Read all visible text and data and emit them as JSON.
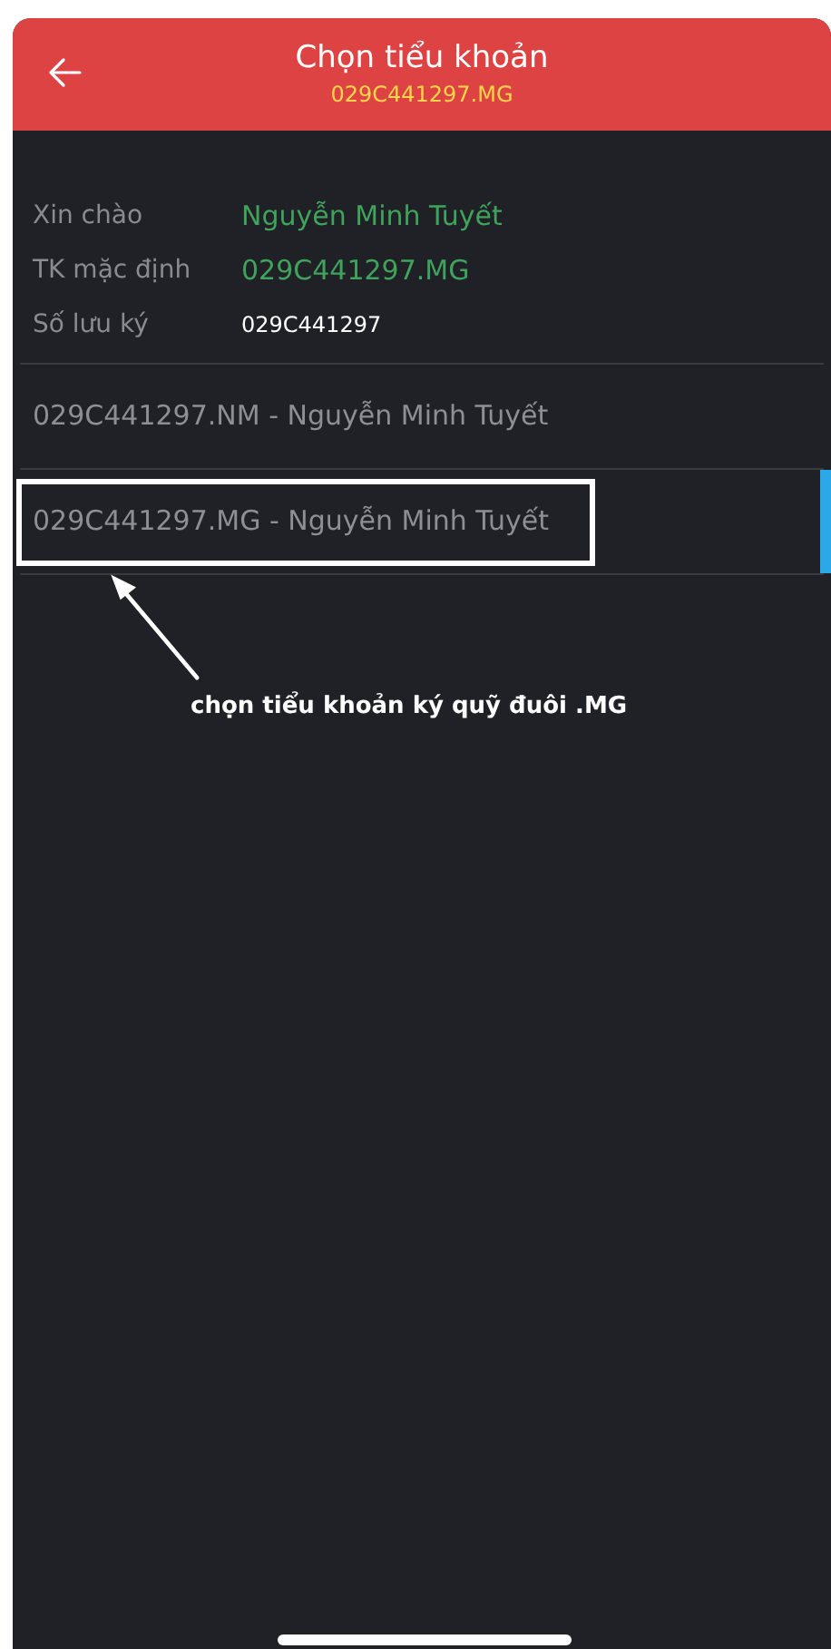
{
  "header": {
    "title": "Chọn tiểu khoản",
    "subtitle": "029C441297.MG"
  },
  "info": [
    {
      "label": "Xin chào",
      "value": "Nguyễn Minh Tuyết",
      "kind": "accent"
    },
    {
      "label": "TK mặc định",
      "value": "029C441297.MG",
      "kind": "accent"
    },
    {
      "label": "Số lưu ký",
      "value": "029C441297",
      "kind": "plain"
    }
  ],
  "accounts": [
    {
      "label": "029C441297.NM - Nguyễn Minh Tuyết",
      "selected": false
    },
    {
      "label": "029C441297.MG - Nguyễn Minh Tuyết",
      "selected": true
    }
  ],
  "annotation": {
    "caption": "chọn tiểu khoản ký quỹ đuôi .MG"
  }
}
